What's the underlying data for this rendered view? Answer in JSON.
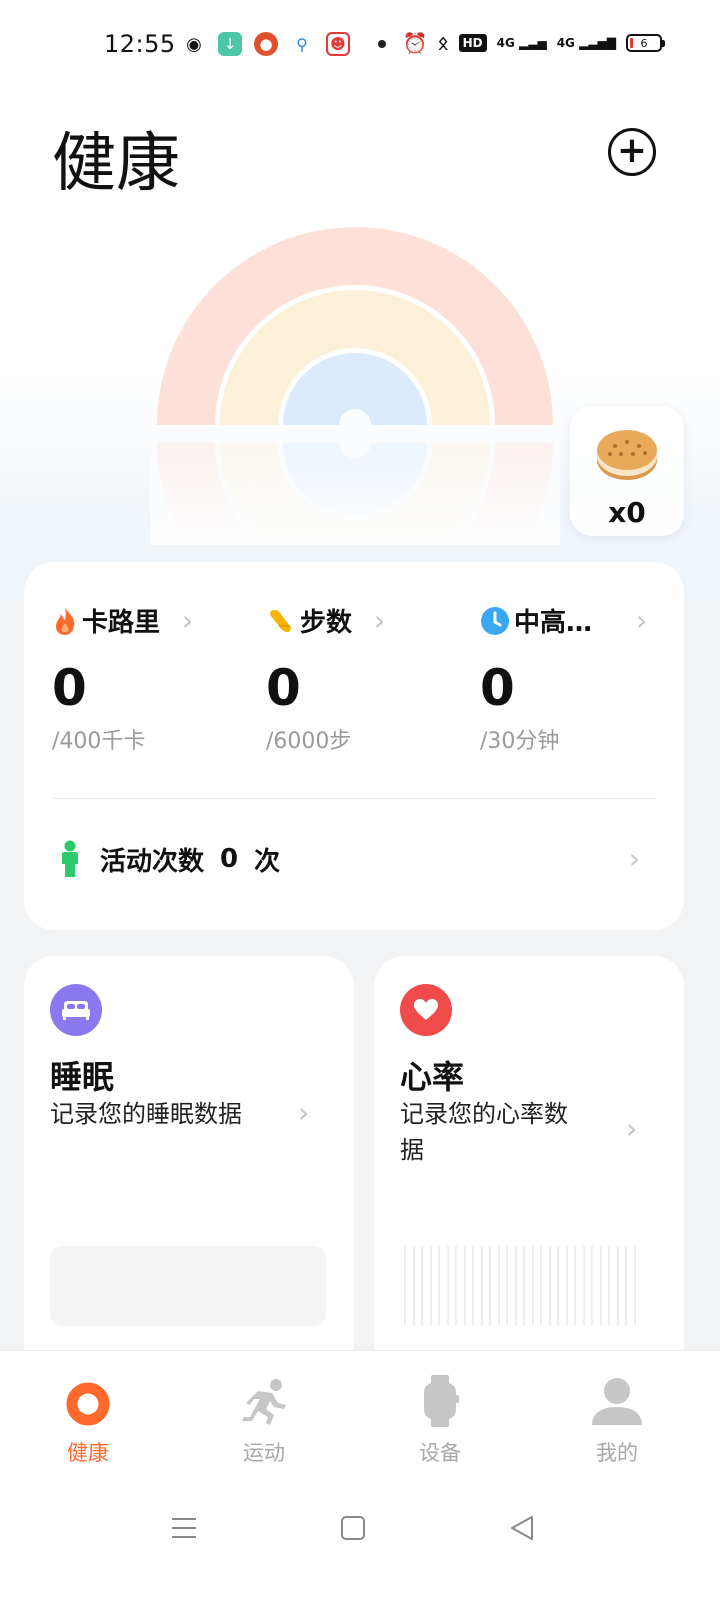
{
  "status_bar": {
    "time": "12:55",
    "network_badge": "HD",
    "signal_1": "4G",
    "signal_2": "4G",
    "battery_level": "6"
  },
  "header": {
    "title": "健康"
  },
  "reward": {
    "count": "x0"
  },
  "activity": {
    "metrics": [
      {
        "label": "卡路里",
        "value": "0",
        "goal": "/400千卡",
        "icon": "flame-icon",
        "color": "#ff6a2c"
      },
      {
        "label": "步数",
        "value": "0",
        "goal": "/6000步",
        "icon": "shoe-icon",
        "color": "#f6b400"
      },
      {
        "label": "中高…",
        "value": "0",
        "goal": "/30分钟",
        "icon": "clock-icon",
        "color": "#3aa8f0"
      }
    ],
    "sessions_label": "活动次数",
    "sessions_count": "0",
    "sessions_unit": "次"
  },
  "sleep": {
    "title": "睡眠",
    "desc": "记录您的睡眠数据",
    "accent": "#8a78f0"
  },
  "heart": {
    "title": "心率",
    "desc_line1": "记录您的心率数",
    "desc_line2": "据",
    "accent": "#f04b4b"
  },
  "bottom_nav": {
    "items": [
      {
        "label": "健康",
        "active": true
      },
      {
        "label": "运动",
        "active": false
      },
      {
        "label": "设备",
        "active": false
      },
      {
        "label": "我的",
        "active": false
      }
    ]
  }
}
